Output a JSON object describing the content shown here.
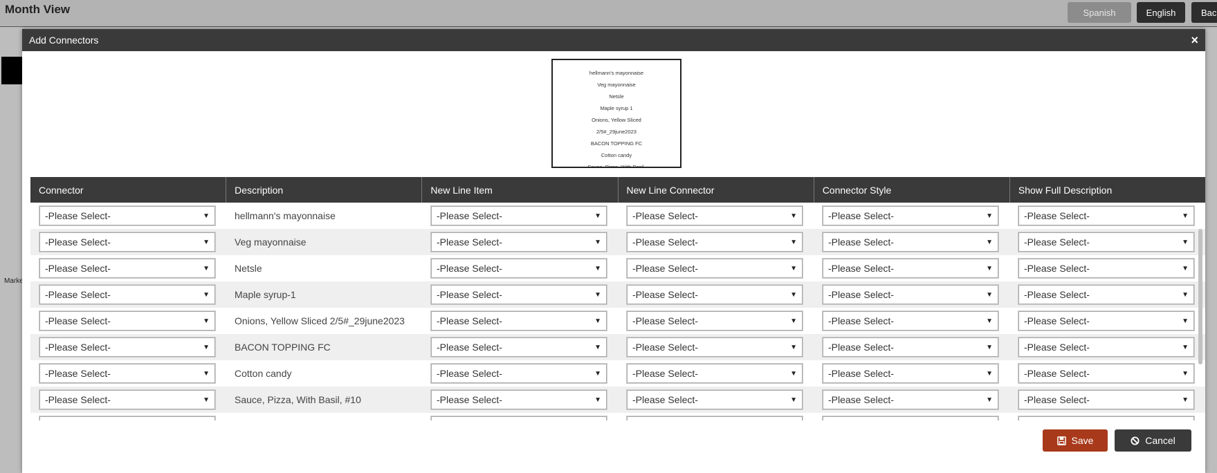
{
  "background": {
    "title": "Month View",
    "languages": {
      "spanish": "Spanish",
      "english": "English",
      "back": "Back"
    },
    "side_text": "Marke"
  },
  "modal": {
    "title": "Add Connectors",
    "close_symbol": "×",
    "preview_lines": [
      "hellmann's mayonnaise",
      "Veg mayonnaise",
      "Netsle",
      "Maple syrup 1",
      "Onions, Yellow Sliced",
      "2/5#_29june2023",
      "BACON TOPPING FC",
      "Cotton candy",
      "Sauce, Pizza, With Basil,"
    ],
    "columns": [
      "Connector",
      "Description",
      "New Line Item",
      "New Line Connector",
      "Connector Style",
      "Show Full Description"
    ],
    "select_placeholder": "-Please Select-",
    "rows": [
      {
        "description": "hellmann's mayonnaise"
      },
      {
        "description": "Veg mayonnaise"
      },
      {
        "description": "Netsle"
      },
      {
        "description": "Maple syrup-1"
      },
      {
        "description": "Onions, Yellow Sliced 2/5#_29june2023"
      },
      {
        "description": "BACON TOPPING FC"
      },
      {
        "description": "Cotton candy"
      },
      {
        "description": "Sauce, Pizza, With Basil, #10"
      },
      {
        "description": ""
      }
    ],
    "footer": {
      "save_label": "Save",
      "cancel_label": "Cancel"
    }
  },
  "colors": {
    "header": "#3a3a3a",
    "save": "#a8391a",
    "cancel": "#3a3a3a"
  }
}
